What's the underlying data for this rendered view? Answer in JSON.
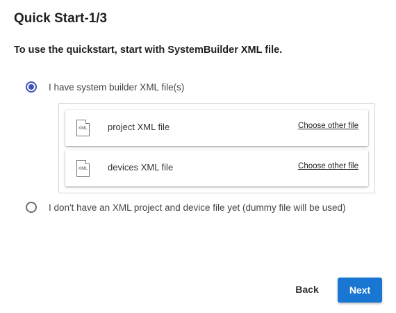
{
  "dialog": {
    "title": "Quick Start-1/3",
    "subtitle": "To use the quickstart, start with SystemBuilder XML file."
  },
  "options": [
    {
      "label": "I have system builder XML file(s)",
      "checked": true
    },
    {
      "label": "I don't have an XML project and device file yet (dummy file will be used)",
      "checked": false
    }
  ],
  "files": [
    {
      "icon_text": "XML",
      "icon": "file-icon",
      "name": "project XML file",
      "link": "Choose other file"
    },
    {
      "icon_text": "XML",
      "icon": "file-icon",
      "name": "devices XML file",
      "link": "Choose other file"
    }
  ],
  "buttons": {
    "back": "Back",
    "next": "Next"
  },
  "colors": {
    "accent": "#3f51b5",
    "primary_button": "#1976d2"
  }
}
